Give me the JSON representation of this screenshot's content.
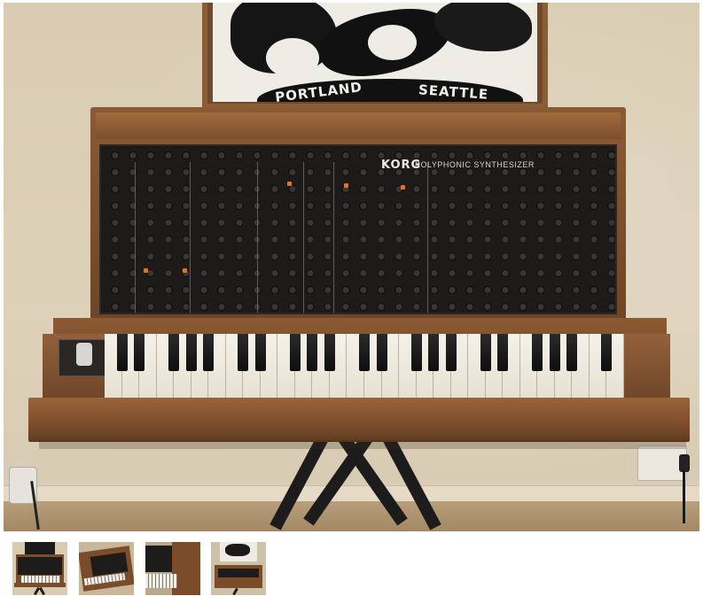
{
  "gallery": {
    "main_image": {
      "poster_text": [
        "PORTLAND",
        "SEATTLE"
      ],
      "panel_brand": "KORG",
      "panel_model": "POLYPHONIC SYNTHESIZER"
    },
    "thumbnails": [
      {
        "selected": true
      },
      {
        "selected": false
      },
      {
        "selected": false
      },
      {
        "selected": false
      }
    ]
  },
  "colors": {
    "wall": "#ddd1b9",
    "wood": "#8a5a34",
    "panel": "#1d1b19",
    "led": "#e0712e"
  }
}
